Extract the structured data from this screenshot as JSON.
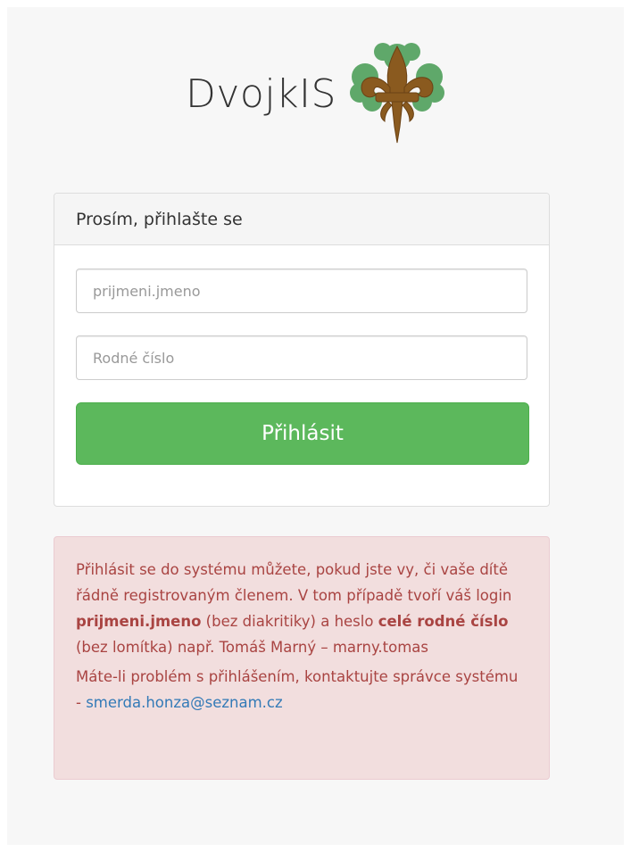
{
  "brand": {
    "title": "DvojkIS",
    "logo_icon": "fleur-de-lis-logo"
  },
  "login_panel": {
    "heading": "Prosím, přihlašte se",
    "username": {
      "value": "",
      "placeholder": "prijmeni.jmeno"
    },
    "password": {
      "value": "",
      "placeholder": "Rodné číslo"
    },
    "submit_label": "Přihlásit"
  },
  "info_alert": {
    "p1_a": "Přihlásit se do systému můžete, pokud jste vy, či vaše dítě řádně registrovaným členem. V tom případě tvoří váš login ",
    "p1_b": "prijmeni.jmeno",
    "p1_c": " (bez diakritiky) a heslo ",
    "p1_d": "celé rodné číslo",
    "p1_e": " (bez lomítka) např. Tomáš Marný – marny.tomas",
    "p2_a": "Máte-li problém s přihlášením, kontaktujte správce systému - ",
    "p2_link": "smerda.honza@seznam.cz"
  },
  "colors": {
    "success": "#5cb85c",
    "danger_text": "#a94442",
    "danger_bg": "#f2dede",
    "link": "#337ab7",
    "logo_green": "#5fa86a",
    "logo_brown": "#8a5a1f"
  }
}
